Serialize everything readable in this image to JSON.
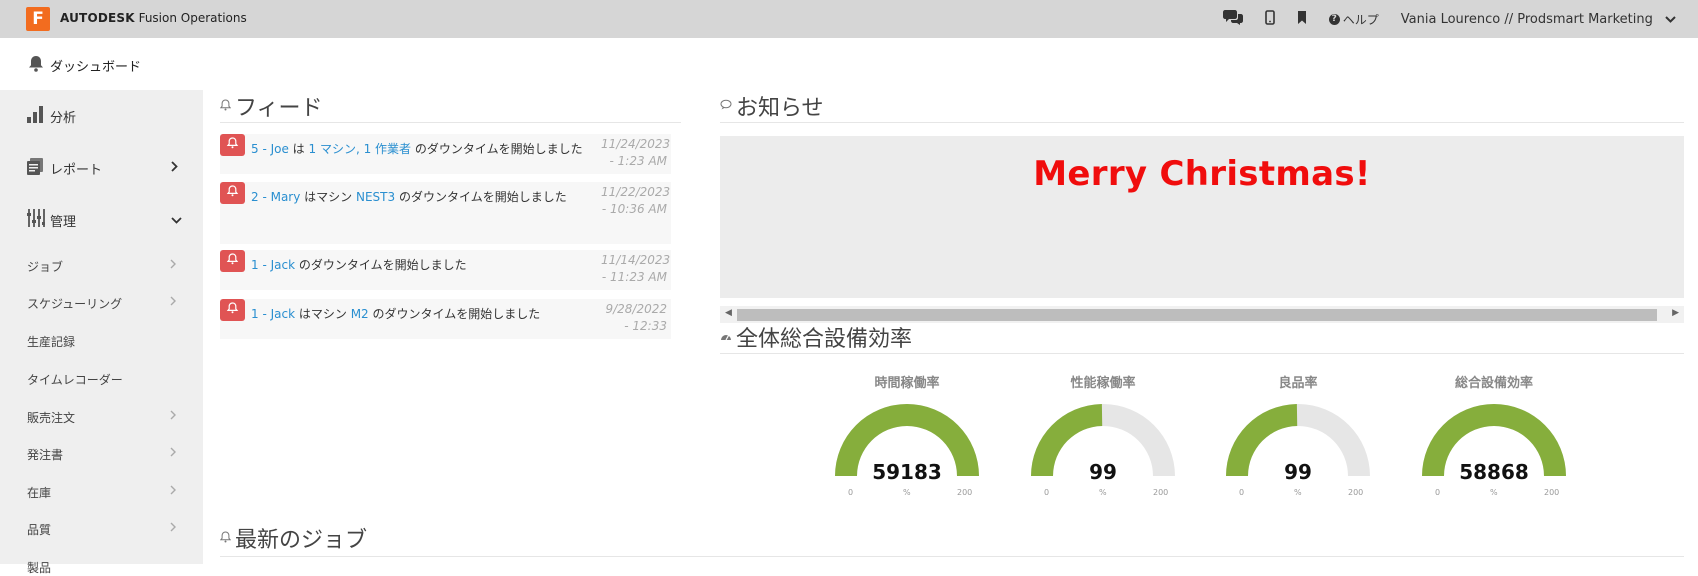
{
  "topbar": {
    "logo_letter": "F",
    "brand": "AUTODESK",
    "product": "Fusion Operations",
    "help_label": "ヘルプ",
    "user": "Vania Lourenco // Prodsmart Marketing",
    "icons": [
      "chat-icon",
      "mobile-icon",
      "bookmark-icon",
      "help-icon",
      "chevron-down-icon"
    ]
  },
  "subbar": {
    "label": "ダッシュボード"
  },
  "sidebar": {
    "main": [
      {
        "label": "分析",
        "icon": "bar-chart-icon"
      },
      {
        "label": "レポート",
        "icon": "report-icon"
      },
      {
        "label": "管理",
        "icon": "sliders-icon"
      }
    ],
    "sub": [
      {
        "label": "ジョブ",
        "chevron": true
      },
      {
        "label": "スケジューリング",
        "chevron": true
      },
      {
        "label": "生産記録",
        "chevron": false
      },
      {
        "label": "タイムレコーダー",
        "chevron": false
      },
      {
        "label": "販売注文",
        "chevron": true
      },
      {
        "label": "発注書",
        "chevron": true
      },
      {
        "label": "在庫",
        "chevron": true
      },
      {
        "label": "品質",
        "chevron": true
      },
      {
        "label": "製品",
        "chevron": false
      }
    ]
  },
  "feed": {
    "title": "フィード",
    "items": [
      {
        "parts": [
          [
            "5 - Joe",
            true
          ],
          [
            " は ",
            false
          ],
          [
            "1 マシン, 1 作業者",
            true
          ],
          [
            " のダウンタイムを開始しました",
            false
          ]
        ],
        "date": "11/24/2023 - 1:23 AM"
      },
      {
        "parts": [
          [
            "2 - Mary",
            true
          ],
          [
            " はマシン ",
            false
          ],
          [
            "NEST3",
            true
          ],
          [
            " のダウンタイムを開始しました",
            false
          ]
        ],
        "date": "11/22/2023 - 10:36 AM"
      },
      {
        "parts": [
          [
            "1 - Jack",
            true
          ],
          [
            " のダウンタイムを開始しました",
            false
          ]
        ],
        "date": "11/14/2023 - 11:23 AM"
      },
      {
        "parts": [
          [
            "1 - Jack",
            true
          ],
          [
            " はマシン ",
            false
          ],
          [
            "M2",
            true
          ],
          [
            " のダウンタイムを開始しました",
            false
          ]
        ],
        "date": "9/28/2022 - 12:33"
      }
    ]
  },
  "notice": {
    "title": "お知らせ",
    "message": "Merry Christmas!"
  },
  "oee": {
    "title": "全体総合設備効率",
    "gauges": [
      {
        "label": "時間稼働率",
        "value": "59183",
        "fraction": 1.0,
        "min": "0",
        "max": "200",
        "unit": "%"
      },
      {
        "label": "性能稼働率",
        "value": "99",
        "fraction": 0.495,
        "min": "0",
        "max": "200",
        "unit": "%"
      },
      {
        "label": "良品率",
        "value": "99",
        "fraction": 0.495,
        "min": "0",
        "max": "200",
        "unit": "%"
      },
      {
        "label": "総合設備効率",
        "value": "58868",
        "fraction": 1.0,
        "min": "0",
        "max": "200",
        "unit": "%"
      }
    ],
    "colors": {
      "fill": "#86ae3c",
      "track": "#e6e6e6"
    }
  },
  "latest_jobs": {
    "title": "最新のジョブ"
  }
}
